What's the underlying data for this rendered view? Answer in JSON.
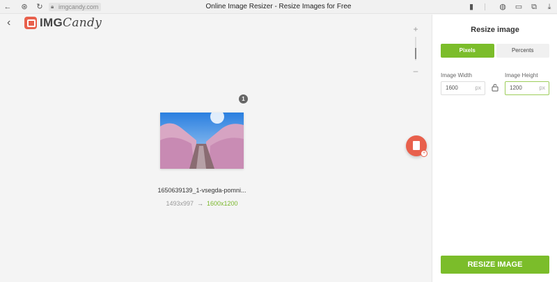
{
  "browser": {
    "url": "imgcandy.com",
    "title": "Online Image Resizer - Resize Images for Free",
    "icons": [
      "back-icon",
      "forward-icon",
      "shield-icon",
      "reload-icon",
      "bookmark-icon",
      "globe-icon",
      "battery-icon",
      "translate-icon",
      "menu-icon",
      "download-icon"
    ]
  },
  "logo": {
    "img": "IMG",
    "candy": "Candy"
  },
  "zoom": {
    "plus": "+",
    "minus": "–"
  },
  "file": {
    "count": "1",
    "name": "1650639139_1-vsegda-pomni...",
    "original_dims": "1493x997",
    "arrow": "→",
    "new_dims": "1600x1200"
  },
  "panel": {
    "title": "Resize image",
    "tabs": [
      {
        "label": "Pixels",
        "active": true
      },
      {
        "label": "Percents",
        "active": false
      }
    ],
    "width": {
      "label": "Image Width",
      "value": "1600",
      "unit": "px"
    },
    "height": {
      "label": "Image Height",
      "value": "1200",
      "unit": "px"
    },
    "button": "RESIZE IMAGE"
  },
  "colors": {
    "accent": "#7bbd2a",
    "brand": "#e8604c"
  }
}
